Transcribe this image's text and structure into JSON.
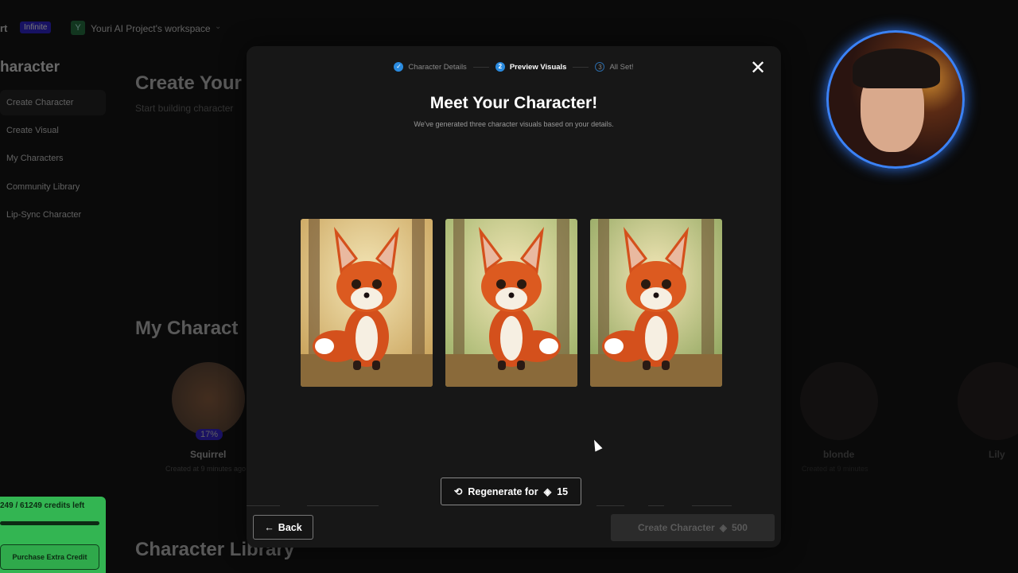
{
  "topbar": {
    "brand": "rt",
    "plan_badge": "Infinite",
    "workspace_initial": "Y",
    "workspace_name": "Youri AI Project's workspace"
  },
  "sidebar": {
    "title": "haracter",
    "items": [
      {
        "label": "Create Character"
      },
      {
        "label": "Create Visual"
      },
      {
        "label": "My Characters"
      },
      {
        "label": "Community Library"
      },
      {
        "label": "Lip-Sync Character"
      }
    ]
  },
  "credits": {
    "text": "249 / 61249 credits left",
    "purchase_label": "Purchase Extra Credit"
  },
  "background": {
    "create_title": "Create Your",
    "create_sub": "Start building character",
    "my_characters_title": "My Charact",
    "library_title": "Character Library",
    "characters": [
      {
        "name": "Squirrel",
        "sub": "Created at 9 minutes ago",
        "progress": "17%"
      },
      {
        "name": "blonde",
        "sub": "Created at 9 minutes"
      },
      {
        "name": "Lily",
        "sub": ""
      }
    ]
  },
  "modal": {
    "steps": [
      {
        "num": "✓",
        "label": "Character Details"
      },
      {
        "num": "2",
        "label": "Preview Visuals"
      },
      {
        "num": "3",
        "label": "All Set!"
      }
    ],
    "title": "Meet Your Character!",
    "subtitle": "We've generated three character visuals based on your details.",
    "regenerate_label": "Regenerate for",
    "regenerate_cost": "15",
    "back_label": "Back",
    "create_label": "Create Character",
    "create_cost": "500"
  },
  "colors": {
    "accent": "#2a8be0",
    "credits_green": "#33b552",
    "badge": "#2a1fd0"
  }
}
